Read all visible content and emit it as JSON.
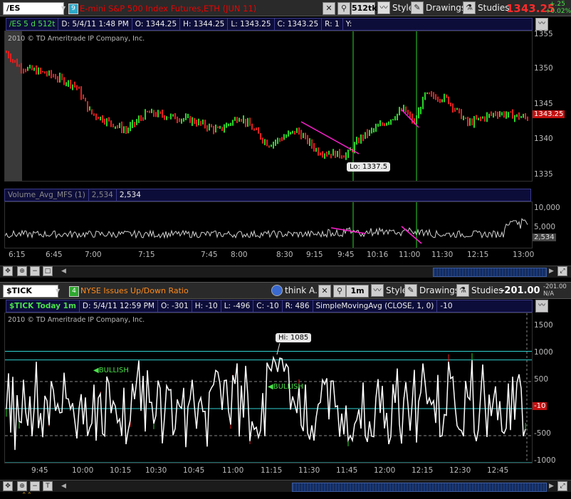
{
  "top": {
    "symbol": "/ES",
    "link_num": "9",
    "description": "E-mini S&P 500 Index Futures,ETH (JUN 11)",
    "aggregation": "512tk",
    "style_label": "Style",
    "drawings_label": "Drawings",
    "studies_label": "Studies",
    "last_price": "1343.25",
    "change": "+.25",
    "change_pct": "+0.02%",
    "header": {
      "title": "/ES 5 d 512t",
      "date": "D: 5/4/11 1:48 PM",
      "open": "O: 1344.25",
      "high": "H: 1344.25",
      "low": "L: 1343.25",
      "close": "C: 1343.25",
      "range": "R: 1",
      "y": "Y:"
    },
    "copyright": "2010 © TD Ameritrade IP Company, Inc.",
    "price_axis": [
      "1355",
      "1350",
      "1345",
      "1340",
      "1335"
    ],
    "price_tag": "1343.25",
    "lo_label": "Lo: 1337.5",
    "volume": {
      "study": "Volume_Avg_MFS (1)",
      "val1": "2,534",
      "val2": "2,534",
      "axis": [
        "10,000",
        "5,000"
      ],
      "tag": "2,534"
    },
    "time_axis": [
      "6:15",
      "6:45",
      "7:00",
      "7:15",
      "7:45",
      "8:00",
      "8:30",
      "9:15",
      "9:45",
      "10:16",
      "11:00",
      "11:30",
      "12:15",
      "13:00"
    ]
  },
  "bottom": {
    "symbol": "$TICK",
    "link_num": "4",
    "description": "NYSE Issues Up/Down Ratio",
    "think_ai": "think A.I.",
    "aggregation": "1m",
    "style_label": "Style",
    "drawings_label": "Drawings",
    "studies_label": "Studies",
    "last_price": "-201.00",
    "side_top": "-201.00",
    "side_bottom": "N/A",
    "header": {
      "title": "$TICK Today 1m",
      "date": "D: 5/4/11 12:59 PM",
      "open": "O: -301",
      "high": "H: -10",
      "low": "L: -496",
      "close": "C: -10",
      "range": "R: 486",
      "study": "SimpleMovingAvg (CLOSE, 1, 0)",
      "study_val": "-10"
    },
    "copyright": "2010 © TD Ameritrade IP Company, Inc.",
    "y_axis": [
      "1500",
      "1000",
      "500",
      "0",
      "-500",
      "-1000"
    ],
    "tick_tag": "-10",
    "hi_label": "Hi: 1085",
    "bullish1": "BULLISH",
    "bullish2": "BULLISH",
    "time_axis": [
      "9:45",
      "10:00",
      "10:15",
      "10:30",
      "10:45",
      "11:00",
      "11:15",
      "11:30",
      "11:45",
      "12:00",
      "12:15",
      "12:30",
      "12:45"
    ]
  },
  "colors": {
    "up_bar": "#2bd62b",
    "down_bar": "#e02020",
    "trendline": "#ff1fd0",
    "vertical": "#2bd62b",
    "cyan": "#30d0d0"
  }
}
